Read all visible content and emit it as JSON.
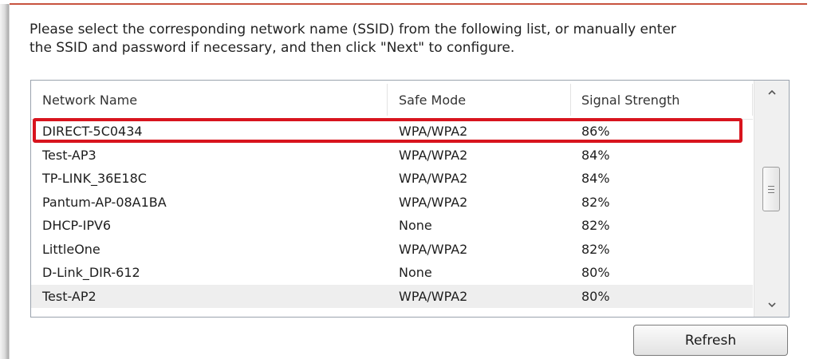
{
  "instructions": {
    "line1": "Please select the corresponding network name (SSID) from the following list, or manually enter",
    "line2": "the SSID and password if necessary, and then click \"Next\" to configure."
  },
  "network_list": {
    "columns": {
      "network_name": "Network Name",
      "safe_mode": "Safe Mode",
      "signal_strength": "Signal Strength"
    },
    "rows": [
      {
        "name": "DIRECT-5C0434",
        "mode": "WPA/WPA2",
        "signal": "86%"
      },
      {
        "name": "Test-AP3",
        "mode": "WPA/WPA2",
        "signal": "84%"
      },
      {
        "name": "TP-LINK_36E18C",
        "mode": "WPA/WPA2",
        "signal": "84%"
      },
      {
        "name": "Pantum-AP-08A1BA",
        "mode": "WPA/WPA2",
        "signal": "82%"
      },
      {
        "name": "DHCP-IPV6",
        "mode": "None",
        "signal": "82%"
      },
      {
        "name": "LittleOne",
        "mode": "WPA/WPA2",
        "signal": "82%"
      },
      {
        "name": "D-Link_DIR-612",
        "mode": "None",
        "signal": "80%"
      },
      {
        "name": "Test-AP2",
        "mode": "WPA/WPA2",
        "signal": "80%"
      }
    ],
    "highlighted_row_color": "#d8141e",
    "scroll": {
      "up_icon": "chevron-up-icon",
      "down_icon": "chevron-down-icon",
      "thumb_icon": "grip-icon"
    }
  },
  "buttons": {
    "refresh_label": "Refresh"
  },
  "colors": {
    "accent": "#c8533f",
    "selection_border": "#d8141e"
  }
}
